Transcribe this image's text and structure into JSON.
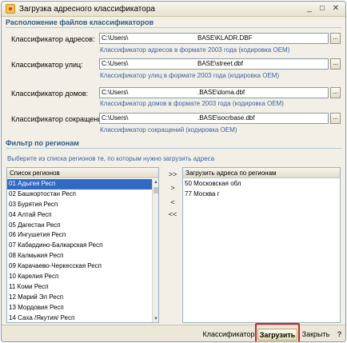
{
  "window": {
    "title": "Загрузка адресного классификатора",
    "controls": {
      "minimize": "_",
      "maximize": "□",
      "close": "✕"
    }
  },
  "files_section": {
    "header": "Расположение файлов классификаторов",
    "rows": [
      {
        "label": "Классификатор адресов:",
        "path_user": "C:\\Users\\",
        "path_base": "BASE\\KLADR.DBF",
        "hint": "Классификатор адресов в формате  2003 года  (кодировка OEM)",
        "button": "..."
      },
      {
        "label": "Классификатор улиц:",
        "path_user": "C:\\Users\\",
        "path_base": "BASE\\street.dbf",
        "hint": "Классификатор улиц в формате  2003 года  (кодировка OEM)",
        "button": "..."
      },
      {
        "label": "Классификатор домов:",
        "path_user": "C:\\Users\\",
        "path_base": ".BASE\\doma.dbf",
        "hint": "Классификатор домов в формате  2003 года  (кодировка OEM)",
        "button": "..."
      },
      {
        "label": "Классификатор сокращений:",
        "path_user": "C:\\Users\\",
        "path_base": ".BASE\\socrbase.dbf",
        "hint": "Классификатор сокращений (кодировка OEM)",
        "button": "..."
      }
    ]
  },
  "filter_section": {
    "header": "Фильтр по регионам",
    "hint": "Выберите из списка регионов те, по которым нужно загрузить адреса",
    "regions_header": "Список регионов",
    "regions": [
      "01 Адыгея Респ",
      "02 Башкортостан Респ",
      "03 Бурятия Респ",
      "04 Алтай Респ",
      "05 Дагестан Респ",
      "06 Ингушетия Респ",
      "07 Кабардино-Балкарская Респ",
      "08 Калмыкия Респ",
      "09 Карачаево-Черкесская Респ",
      "10 Карелия Респ",
      "11 Коми Респ",
      "12 Марий Эл Респ",
      "13 Мордовия Респ",
      "14 Саха /Якутия/ Респ"
    ],
    "selected_header": "Загрузить адреса по регионам",
    "selected": [
      "50 Московская обл",
      "77 Москва г"
    ],
    "move_buttons": {
      "all_right": ">>",
      "right": ">",
      "left": "<",
      "all_left": "<<"
    }
  },
  "footer": {
    "classifier_label": "Классификатор",
    "load_label": "Загрузить",
    "close_label": "Закрыть",
    "help_label": "?"
  },
  "colors": {
    "section_header": "#2f5a86",
    "hint": "#3a5fa6",
    "selection": "#316ac5",
    "highlight": "#d0262a"
  }
}
